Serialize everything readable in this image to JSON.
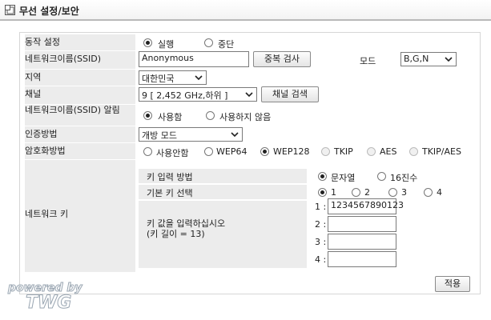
{
  "header": {
    "title": "무선 설정/보안",
    "icon": "windows-icon"
  },
  "operation": {
    "label": "동작 설정",
    "options": [
      "실행",
      "중단"
    ],
    "selected": 0
  },
  "ssid": {
    "label": "네트워크이름(SSID)",
    "value": "Anonymous",
    "dup_check_label": "중복 검사",
    "mode_label": "모드",
    "mode_value": "B,G,N"
  },
  "region": {
    "label": "지역",
    "value": "대한민국"
  },
  "channel": {
    "label": "채널",
    "value": "9 [ 2,452 GHz,하위 ]",
    "search_label": "채널 검색"
  },
  "ssid_broadcast": {
    "label": "네트워크이름(SSID) 알림",
    "options": [
      "사용함",
      "사용하지 않음"
    ],
    "selected": 0
  },
  "auth": {
    "label": "인증방법",
    "value": "개방 모드"
  },
  "encryption": {
    "label": "암호화방법",
    "options": [
      "사용안함",
      "WEP64",
      "WEP128",
      "TKIP",
      "AES",
      "TKIP/AES"
    ],
    "selected": 2,
    "disabled": [
      3,
      4,
      5
    ]
  },
  "network_key": {
    "label": "네트워크 키",
    "input_method_label": "키 입력 방법",
    "input_methods": [
      "문자열",
      "16진수"
    ],
    "input_method_selected": 0,
    "default_key_label": "기본 키 선택",
    "default_keys": [
      "1",
      "2",
      "3",
      "4"
    ],
    "default_key_selected": 0,
    "enter_prompt": "키 값을 입력하십시오",
    "key_length_note": "(키 길이 = 13)",
    "keys": [
      {
        "index": "1 :",
        "value": "1234567890123"
      },
      {
        "index": "2 :",
        "value": ""
      },
      {
        "index": "3 :",
        "value": ""
      },
      {
        "index": "4 :",
        "value": ""
      }
    ]
  },
  "apply_label": "적용",
  "branding": {
    "line1": "powered by",
    "line2": "TWG"
  },
  "colors": {
    "label_bg": "#ececec",
    "border": "#d6d6d6"
  }
}
